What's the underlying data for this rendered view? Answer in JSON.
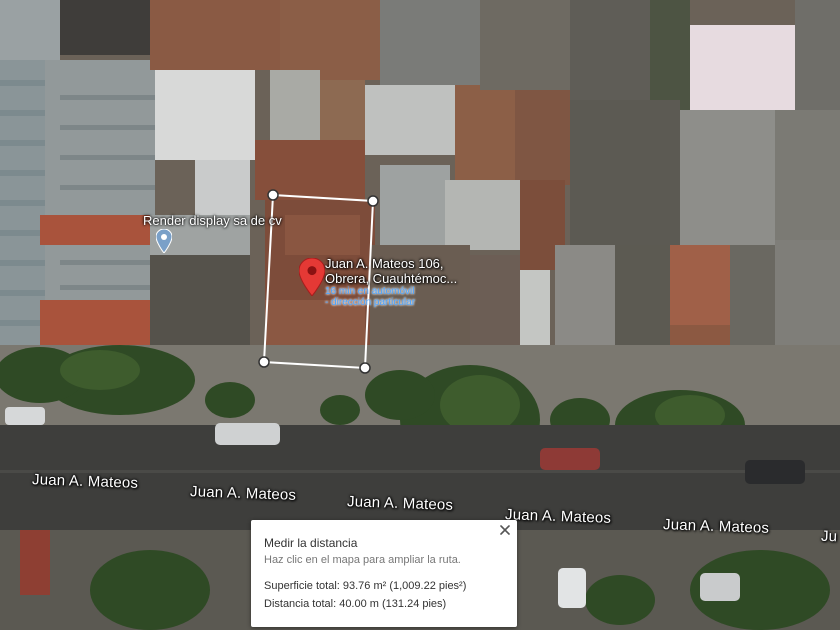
{
  "map": {
    "type": "satellite",
    "street_name": "Juan A. Mateos",
    "street_labels": [
      "Juan A. Mateos",
      "Juan A. Mateos",
      "Juan A. Mateos",
      "Juan A. Mateos",
      "Juan A. Mateos",
      "Ju"
    ],
    "place_label": "Render display sa de cv",
    "place_icon": "place-pin-icon",
    "selected_pin": {
      "icon": "red-location-pin-icon",
      "color": "#e53935",
      "title_line1": "Juan A. Mateos 106,",
      "title_line2": "Obrera, Cuauhtémoc...",
      "sub_line1": "16 min en automóvil",
      "sub_line2": "- dirección particular"
    },
    "measure_outline_color": "#ffffff"
  },
  "measure_card": {
    "title": "Medir la distancia",
    "hint": "Haz clic en el mapa para ampliar la ruta.",
    "area": "Superficie total: 93.76 m² (1,009.22 pies²)",
    "distance": "Distancia total: 40.00 m (131.24 pies)",
    "close_icon": "close-icon"
  }
}
